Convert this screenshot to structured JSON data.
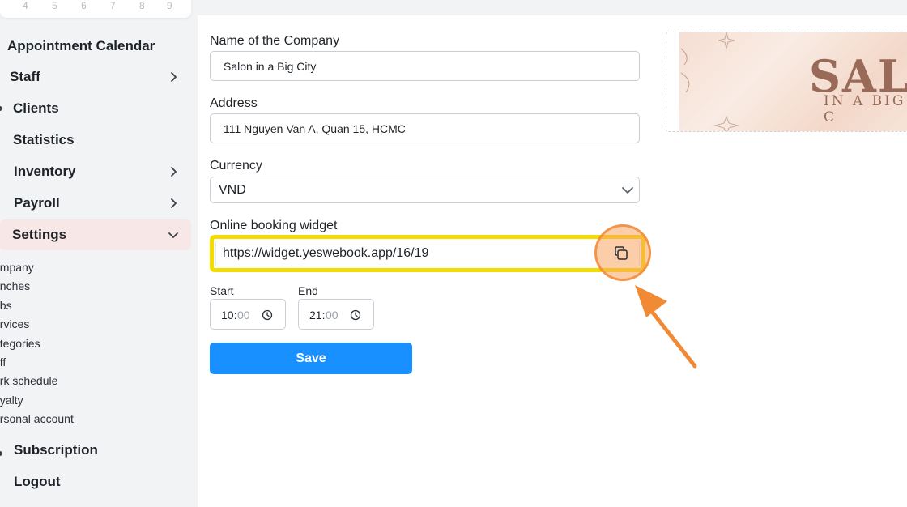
{
  "sidebar": {
    "calendar_digits": [
      "4",
      "5",
      "6",
      "7",
      "8",
      "9"
    ],
    "heading": "Appointment Calendar",
    "items": [
      {
        "label": "Staff",
        "has_chevron": true
      },
      {
        "label": "Clients",
        "has_chevron": false
      },
      {
        "label": "Statistics",
        "has_chevron": false
      },
      {
        "label": "Inventory",
        "has_chevron": true
      },
      {
        "label": "Payroll",
        "has_chevron": true
      },
      {
        "label": "Settings",
        "has_chevron": true,
        "expanded": true
      }
    ],
    "settings_sub_items": [
      "ompany",
      "anches",
      "obs",
      "ervices",
      "ategories",
      "aff",
      "ork schedule",
      "oyalty",
      "ersonal account"
    ],
    "bottom_items": [
      {
        "label": "Subscription"
      },
      {
        "label": "Logout"
      }
    ]
  },
  "form": {
    "company_name_label": "Name of the Company",
    "company_name_value": "Salon in a Big City",
    "address_label": "Address",
    "address_value": "111 Nguyen Van A, Quan 15, HCMC",
    "currency_label": "Currency",
    "currency_value": "VND",
    "widget_label": "Online booking widget",
    "widget_url": "https://widget.yeswebook.app/16/19",
    "start_label": "Start",
    "start_hours": "10:",
    "start_minutes": "00",
    "end_label": "End",
    "end_hours": "21:",
    "end_minutes": "00",
    "save_label": "Save"
  },
  "logo": {
    "line1": "SALO",
    "line2": "IN A BIG C"
  },
  "colors": {
    "primary": "#1890ff",
    "highlight_yellow": "#f5dc00",
    "annotation_orange": "#f08a35",
    "active_nav_bg": "#f7e7e6"
  },
  "icons": {
    "copy": "copy-icon",
    "clock": "clock-icon",
    "chevron": "chevron-right-icon",
    "caret": "chevron-down-icon"
  }
}
